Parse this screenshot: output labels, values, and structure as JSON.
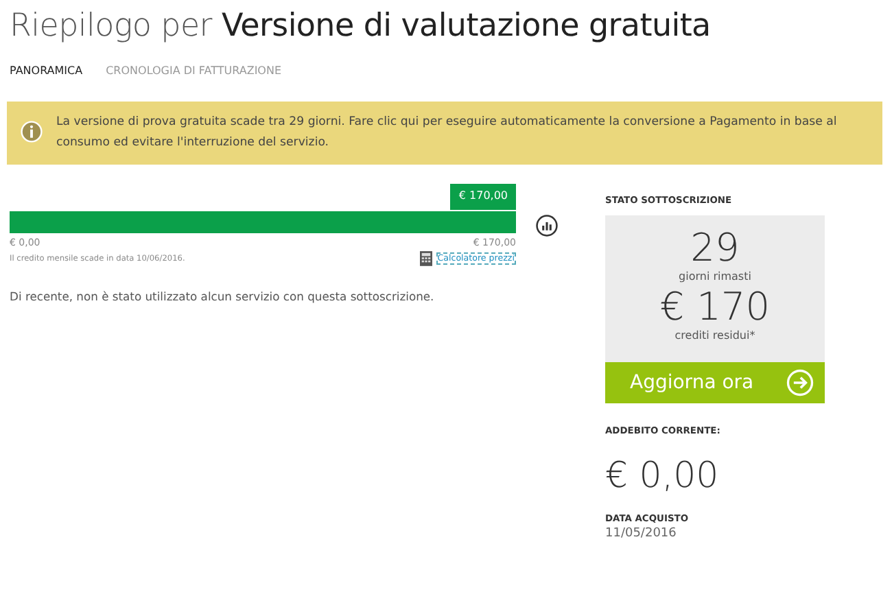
{
  "title": {
    "prefix": "Riepilogo per",
    "name": "Versione di valutazione gratuita"
  },
  "tabs": [
    {
      "label": "PANORAMICA",
      "selected": true
    },
    {
      "label": "CRONOLOGIA DI FATTURAZIONE",
      "selected": false
    }
  ],
  "banner": {
    "text": "La versione di prova gratuita scade tra 29 giorni. Fare clic qui per eseguire automaticamente la conversione a Pagamento in base al consumo ed evitare l'interruzione del servizio."
  },
  "credit": {
    "level": 1,
    "balloon": "€ 170,00",
    "min": "€ 0,00",
    "max": "€ 170,00",
    "note": "Il credito mensile scade in data 10/06/2016.",
    "calculator": "Calcolatore prezzi"
  },
  "usage_message": "Di recente, non è stato utilizzato alcun servizio con questa sottoscrizione.",
  "status": {
    "heading": "STATO SOTTOSCRIZIONE",
    "days": "29",
    "days_label": "giorni rimasti",
    "credits": "€ 170",
    "credits_label": "crediti residui*",
    "button": "Aggiorna ora"
  },
  "current_charge": {
    "heading": "ADDEBITO CORRENTE:",
    "value": "€ 0,00"
  },
  "purchase_date": {
    "heading": "DATA ACQUISTO",
    "value": "11/05/2016"
  }
}
